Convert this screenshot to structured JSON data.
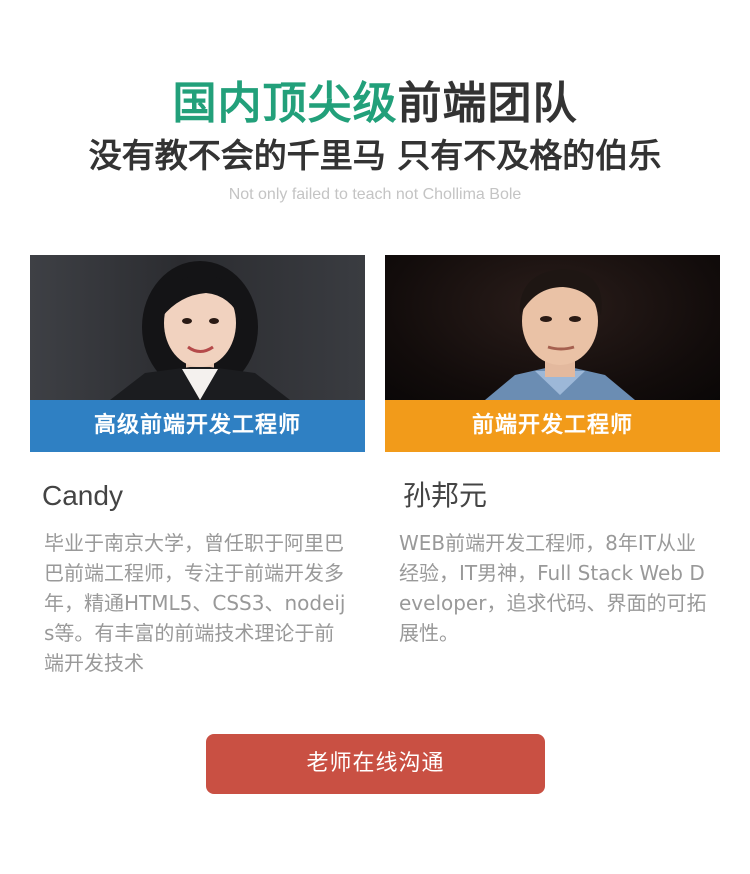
{
  "header": {
    "title_accent": "国内顶尖级",
    "title_rest": "前端团队",
    "subtitle": "没有教不会的千里马 只有不及格的伯乐",
    "tagline": "Not only failed to teach not Chollima Bole"
  },
  "teachers": [
    {
      "role": "高级前端开发工程师",
      "name": "Candy",
      "description": "毕业于南京大学，曾任职于阿里巴巴前端工程师，专注于前端开发多年，精通HTML5、CSS3、nodeijs等。有丰富的前端技术理论于前端开发技术"
    },
    {
      "role": "前端开发工程师",
      "name": "孙邦元",
      "description": "WEB前端开发工程师，8年IT从业经验，IT男神，Full Stack Web Developer，追求代码、界面的可拓展性。"
    }
  ],
  "cta": {
    "label": "老师在线沟通"
  },
  "colors": {
    "accent_green": "#22a07a",
    "role_blue": "#2f80c3",
    "role_orange": "#f29b1a",
    "cta_red": "#c95043"
  }
}
